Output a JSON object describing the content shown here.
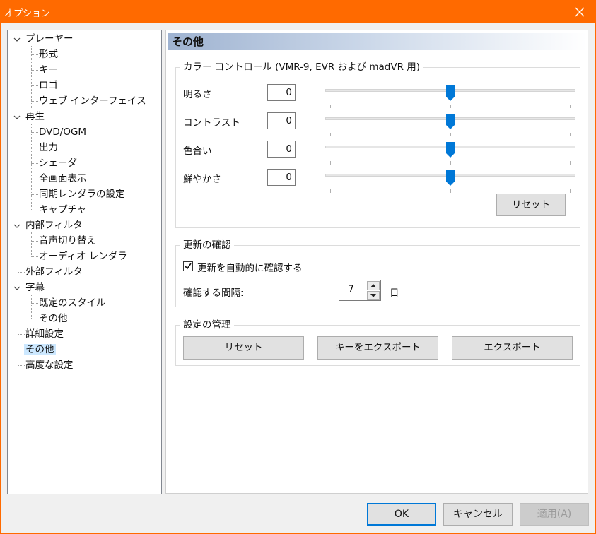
{
  "window": {
    "title": "オプション"
  },
  "tree": {
    "items": [
      {
        "label": "プレーヤー"
      },
      {
        "label": "形式"
      },
      {
        "label": "キー"
      },
      {
        "label": "ロゴ"
      },
      {
        "label": "ウェブ インターフェイス"
      },
      {
        "label": "再生"
      },
      {
        "label": "DVD/OGM"
      },
      {
        "label": "出力"
      },
      {
        "label": "シェーダ"
      },
      {
        "label": "全画面表示"
      },
      {
        "label": "同期レンダラの設定"
      },
      {
        "label": "キャプチャ"
      },
      {
        "label": "内部フィルタ"
      },
      {
        "label": "音声切り替え"
      },
      {
        "label": "オーディオ レンダラ"
      },
      {
        "label": "外部フィルタ"
      },
      {
        "label": "字幕"
      },
      {
        "label": "既定のスタイル"
      },
      {
        "label": "その他"
      },
      {
        "label": "詳細設定"
      },
      {
        "label": "その他"
      },
      {
        "label": "高度な設定"
      }
    ],
    "selected_index": 20
  },
  "panel": {
    "header": "その他",
    "color_control": {
      "title": "カラー コントロール (VMR-9, EVR および madVR 用)",
      "rows": [
        {
          "label": "明るさ",
          "value": "0",
          "slider_position": 0.5
        },
        {
          "label": "コントラスト",
          "value": "0",
          "slider_position": 0.5
        },
        {
          "label": "色合い",
          "value": "0",
          "slider_position": 0.5
        },
        {
          "label": "鮮やかさ",
          "value": "0",
          "slider_position": 0.5
        }
      ],
      "reset_label": "リセット"
    },
    "update": {
      "title": "更新の確認",
      "auto_check_label": "更新を自動的に確認する",
      "auto_check_checked": true,
      "interval_label": "確認する間隔:",
      "interval_value": "7",
      "interval_unit": "日"
    },
    "settings": {
      "title": "設定の管理",
      "reset_label": "リセット",
      "export_keys_label": "キーをエクスポート",
      "export_label": "エクスポート"
    }
  },
  "buttons": {
    "ok": "OK",
    "cancel": "キャンセル",
    "apply": "適用(A)"
  },
  "colors": {
    "titlebar": "#ff6a00",
    "accent": "#0078d7",
    "selection": "#cce8ff"
  }
}
